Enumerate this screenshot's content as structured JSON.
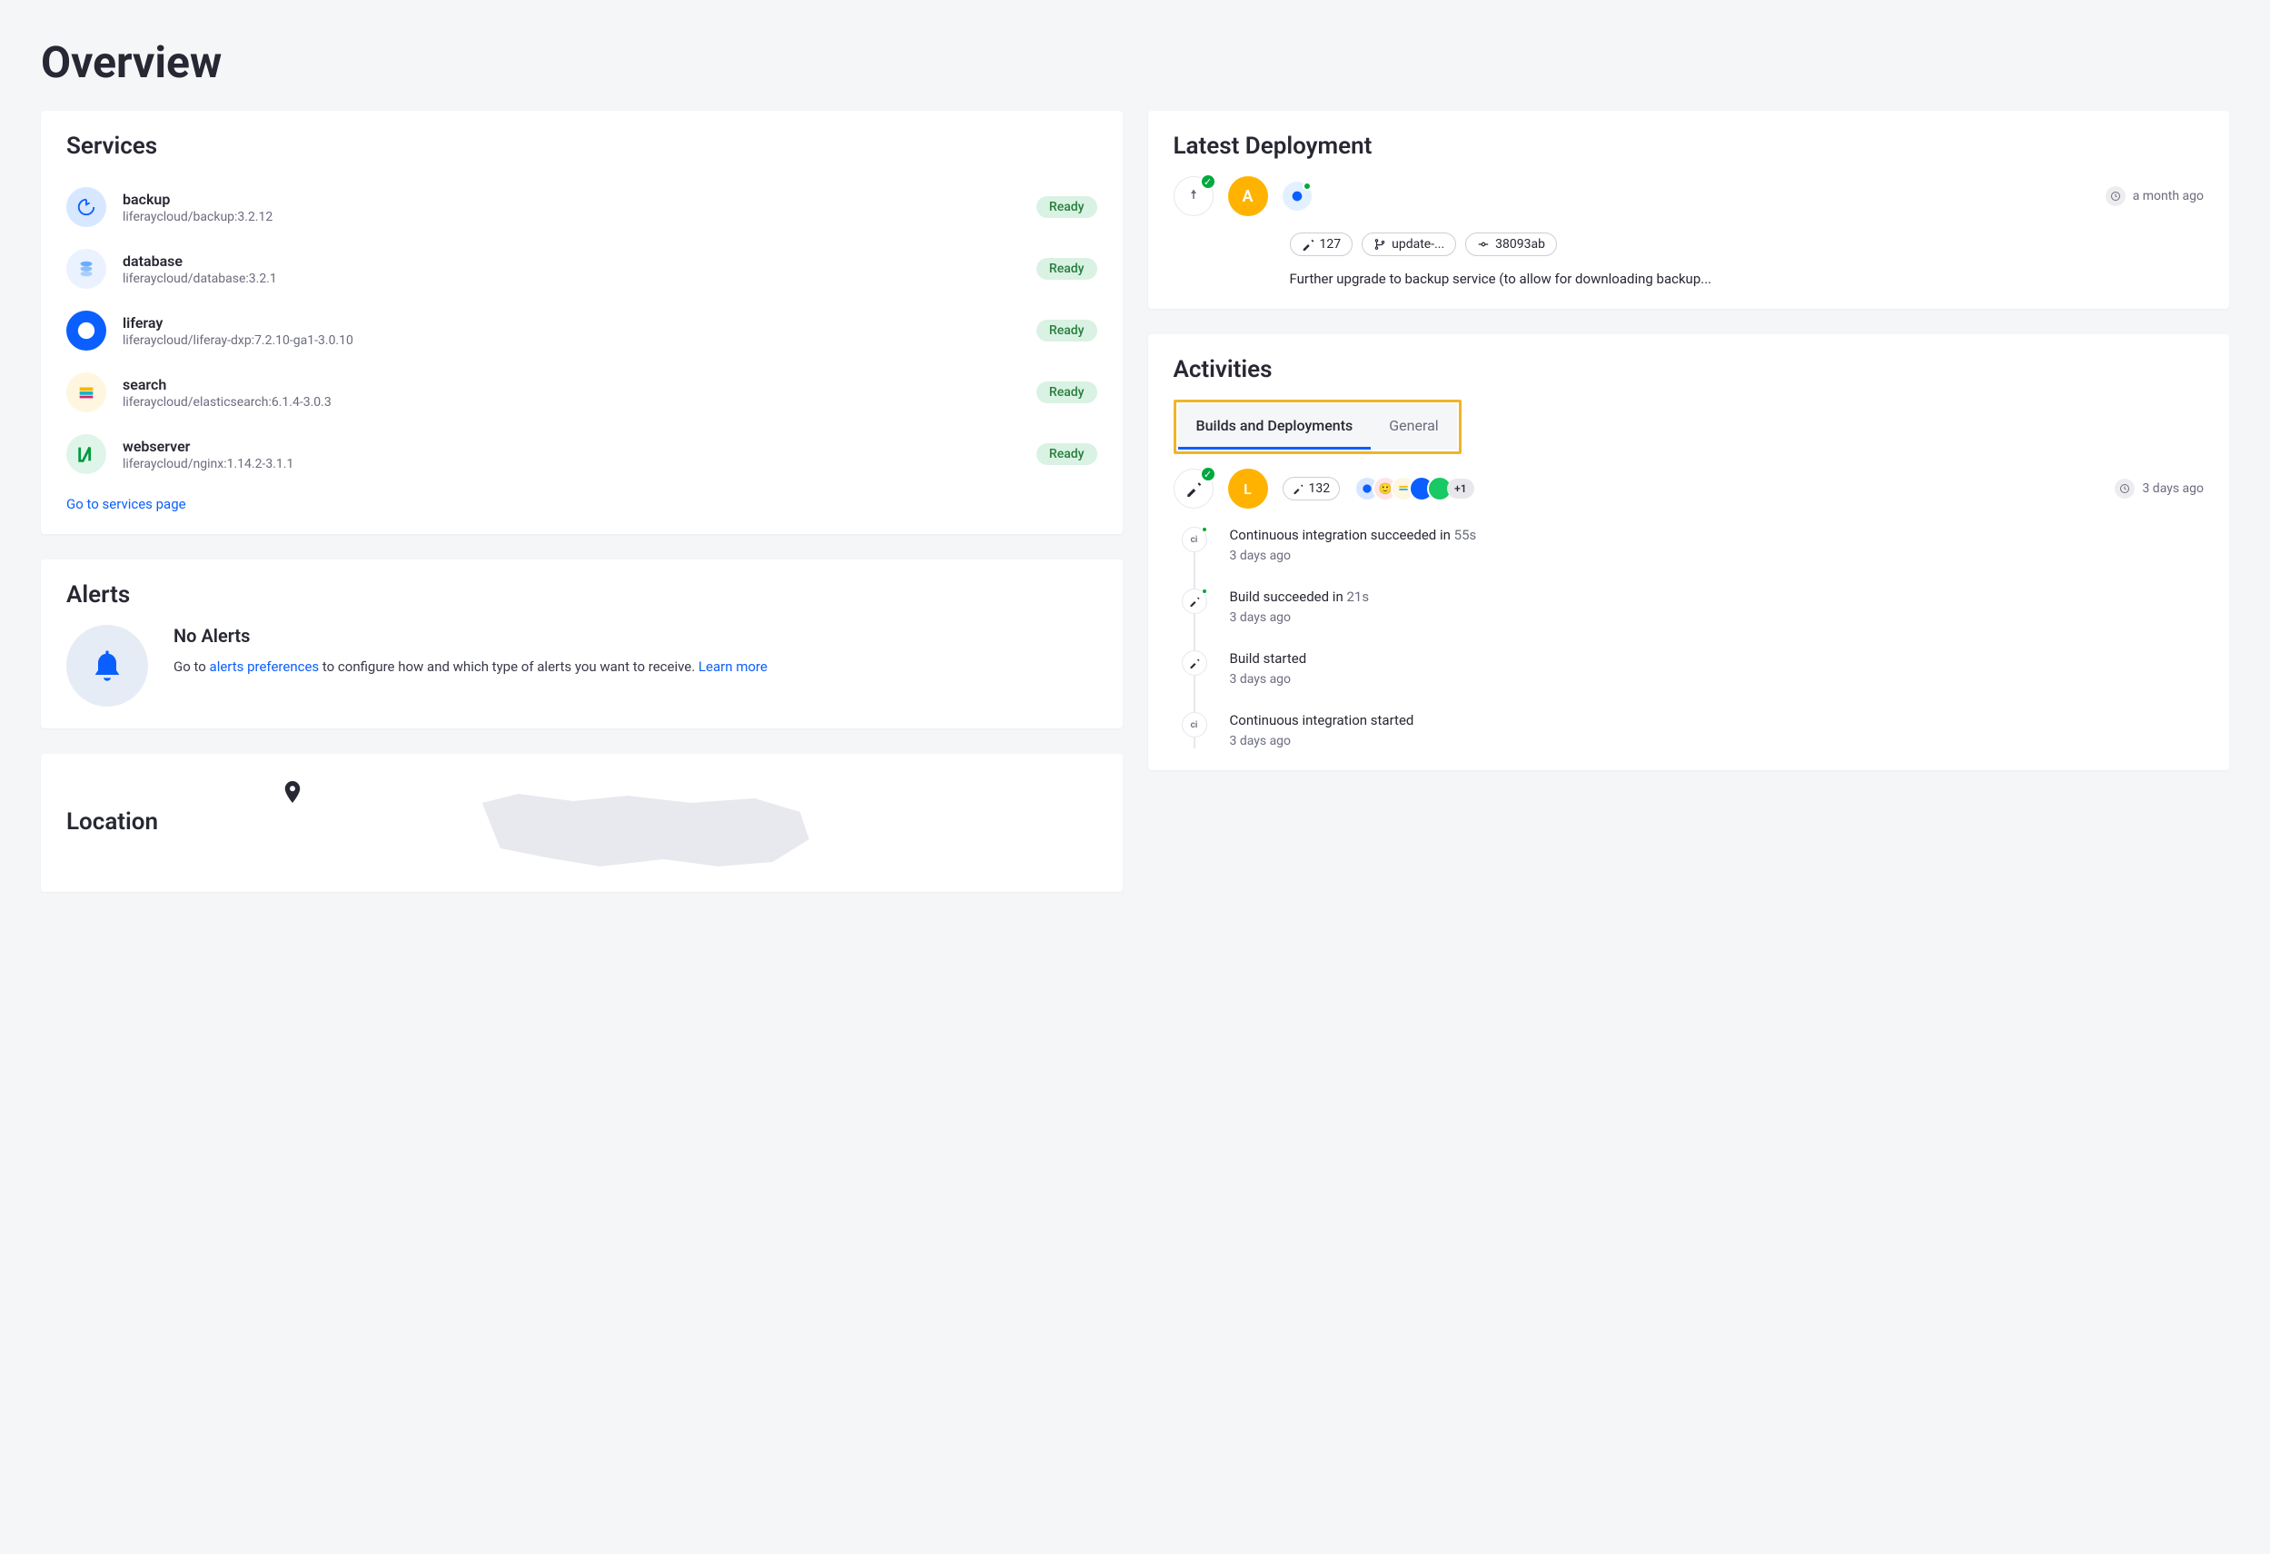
{
  "page": {
    "title": "Overview"
  },
  "services": {
    "heading": "Services",
    "link": "Go to services page",
    "items": [
      {
        "name": "backup",
        "image": "liferaycloud/backup:3.2.12",
        "status": "Ready"
      },
      {
        "name": "database",
        "image": "liferaycloud/database:3.2.1",
        "status": "Ready"
      },
      {
        "name": "liferay",
        "image": "liferaycloud/liferay-dxp:7.2.10-ga1-3.0.10",
        "status": "Ready"
      },
      {
        "name": "search",
        "image": "liferaycloud/elasticsearch:6.1.4-3.0.3",
        "status": "Ready"
      },
      {
        "name": "webserver",
        "image": "liferaycloud/nginx:1.14.2-3.1.1",
        "status": "Ready"
      }
    ]
  },
  "alerts": {
    "heading": "Alerts",
    "title": "No Alerts",
    "text_before": "Go to ",
    "link1": "alerts preferences",
    "text_mid": " to configure how and which type of alerts you want to receive. ",
    "link2": "Learn more"
  },
  "location": {
    "heading": "Location"
  },
  "latest_deployment": {
    "heading": "Latest Deployment",
    "avatar_initial": "A",
    "time": "a month ago",
    "chips": {
      "build": "127",
      "branch": "update-...",
      "commit": "38093ab"
    },
    "message": "Further upgrade to backup service (to allow for downloading backup..."
  },
  "activities": {
    "heading": "Activities",
    "tabs": {
      "builds": "Builds and Deployments",
      "general": "General"
    },
    "head": {
      "avatar_initial": "L",
      "count": "132",
      "overflow": "+1",
      "time": "3 days ago"
    },
    "items": [
      {
        "title_prefix": "Continuous integration succeeded in ",
        "title_suffix": "55s",
        "time": "3 days ago",
        "icon": "ci",
        "ok": true
      },
      {
        "title_prefix": "Build succeeded in ",
        "title_suffix": "21s",
        "time": "3 days ago",
        "icon": "build",
        "ok": true
      },
      {
        "title_prefix": "Build started",
        "title_suffix": "",
        "time": "3 days ago",
        "icon": "build",
        "ok": false
      },
      {
        "title_prefix": "Continuous integration started",
        "title_suffix": "",
        "time": "3 days ago",
        "icon": "ci",
        "ok": false
      }
    ]
  }
}
